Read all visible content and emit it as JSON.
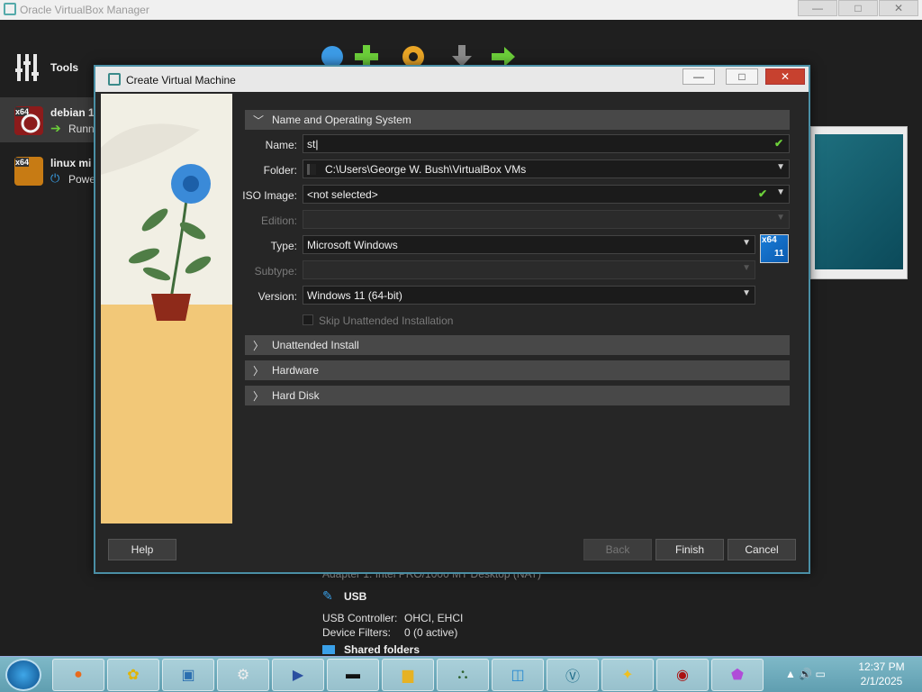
{
  "main_window": {
    "title": "Oracle VirtualBox Manager",
    "controls": {
      "minimize": "—",
      "maximize": "□",
      "close": "✕"
    }
  },
  "sidebar": {
    "tools_label": "Tools",
    "vms": [
      {
        "badge": "x64",
        "name": "debian 1",
        "state": "Runn"
      },
      {
        "badge": "x64",
        "name": "linux mi",
        "state": "Powe"
      }
    ]
  },
  "details": {
    "adapter_partial": "Adapter 1:   Intel PRO/1000 MT Desktop (NAT)",
    "usb_heading": "USB",
    "usb_controller_label": "USB Controller:",
    "usb_controller_value": "OHCI, EHCI",
    "device_filters_label": "Device Filters:",
    "device_filters_value": "0 (0 active)",
    "shared_folders_heading": "Shared folders"
  },
  "dialog": {
    "title": "Create Virtual Machine",
    "controls": {
      "minimize": "—",
      "maximize": "□",
      "close": "✕"
    },
    "sections": {
      "name_os": "Name and Operating System",
      "unattended": "Unattended Install",
      "hardware": "Hardware",
      "hard_disk": "Hard Disk"
    },
    "form": {
      "name_label": "Name:",
      "name_value": "st",
      "folder_label": "Folder:",
      "folder_value": "C:\\Users\\George W. Bush\\VirtualBox VMs",
      "iso_label": "ISO Image:",
      "iso_value": "<not selected>",
      "edition_label": "Edition:",
      "edition_value": "",
      "type_label": "Type:",
      "type_value": "Microsoft Windows",
      "subtype_label": "Subtype:",
      "subtype_value": "",
      "version_label": "Version:",
      "version_value": "Windows 11 (64-bit)",
      "skip_unattended_label": "Skip Unattended Installation",
      "os_badge_top": "x64",
      "os_badge_bottom": "11"
    },
    "buttons": {
      "help": "Help",
      "back": "Back",
      "finish": "Finish",
      "cancel": "Cancel"
    }
  },
  "taskbar": {
    "time": "12:37 PM",
    "date": "2/1/2025"
  }
}
